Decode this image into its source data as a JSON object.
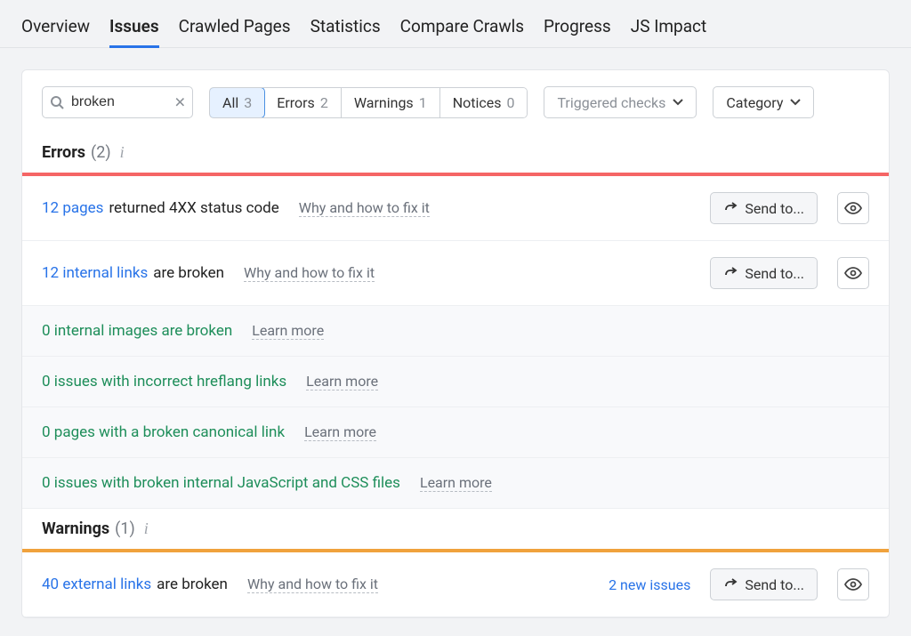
{
  "tabs": [
    {
      "label": "Overview"
    },
    {
      "label": "Issues",
      "active": true
    },
    {
      "label": "Crawled Pages"
    },
    {
      "label": "Statistics"
    },
    {
      "label": "Compare Crawls"
    },
    {
      "label": "Progress"
    },
    {
      "label": "JS Impact"
    }
  ],
  "search": {
    "value": "broken"
  },
  "filters": [
    {
      "label": "All",
      "count": "3",
      "active": true
    },
    {
      "label": "Errors",
      "count": "2"
    },
    {
      "label": "Warnings",
      "count": "1"
    },
    {
      "label": "Notices",
      "count": "0"
    }
  ],
  "dropdowns": {
    "triggered": "Triggered checks",
    "category": "Category"
  },
  "sections": {
    "errors": {
      "title": "Errors",
      "count": "(2)"
    },
    "warnings": {
      "title": "Warnings",
      "count": "(1)"
    }
  },
  "hints": {
    "why_fix": "Why and how to fix it",
    "learn_more": "Learn more"
  },
  "buttons": {
    "send_to": "Send to..."
  },
  "error_issues": [
    {
      "count_text": "12 pages",
      "suffix": "returned 4XX status code",
      "hint": "why_fix",
      "actions": true
    },
    {
      "count_text": "12 internal links",
      "suffix": "are broken",
      "hint": "why_fix",
      "actions": true
    },
    {
      "green_text": "0 internal images are broken",
      "hint": "learn_more",
      "muted": true
    },
    {
      "green_text": "0 issues with incorrect hreflang links",
      "hint": "learn_more",
      "muted": true
    },
    {
      "green_text": "0 pages with a broken canonical link",
      "hint": "learn_more",
      "muted": true
    },
    {
      "green_text": "0 issues with broken internal JavaScript and CSS files",
      "hint": "learn_more",
      "muted": true
    }
  ],
  "warning_issues": [
    {
      "count_text": "40 external links",
      "suffix": "are broken",
      "hint": "why_fix",
      "new_issues": "2 new issues",
      "actions": true
    }
  ]
}
